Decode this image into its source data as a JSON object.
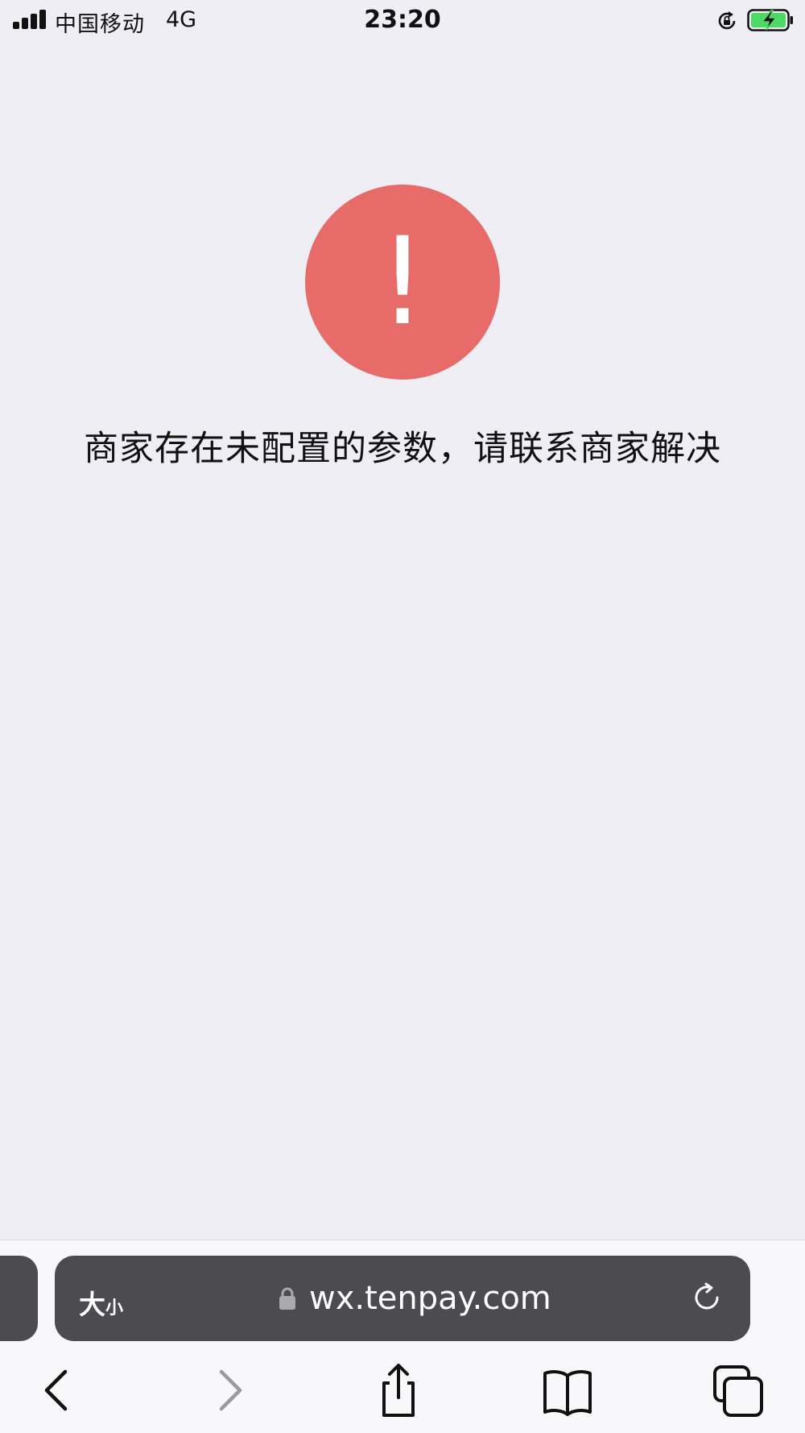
{
  "status_bar": {
    "carrier": "中国移动",
    "network": "4G",
    "time": "23:20"
  },
  "alert": {
    "symbol": "!",
    "message": "商家存在未配置的参数，请联系商家解决",
    "color": "#e76b68"
  },
  "browser": {
    "text_size_label_large": "大",
    "text_size_label_small": "小",
    "url": "wx.tenpay.com"
  },
  "icons": {
    "signal": "signal-bars-icon",
    "orientation_lock": "orientation-lock-icon",
    "battery": "battery-charging-icon",
    "lock": "padlock-icon",
    "reload": "reload-icon",
    "back": "chevron-left-icon",
    "forward": "chevron-right-icon",
    "share": "share-icon",
    "bookmarks": "book-icon",
    "tabs": "tabs-icon"
  },
  "colors": {
    "background": "#efeef4",
    "address_bar": "#4b4b50",
    "battery_fill": "#4cd964"
  }
}
